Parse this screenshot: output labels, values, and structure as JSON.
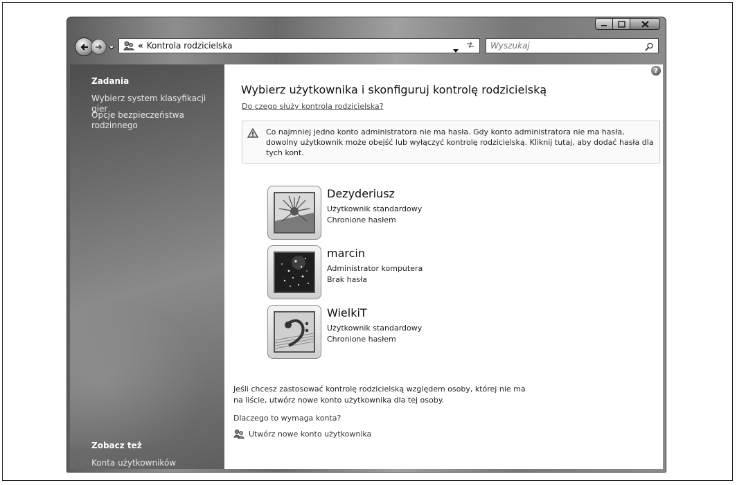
{
  "window": {
    "address": {
      "chevron": "«",
      "location": "Kontrola rodzicielska"
    },
    "search": {
      "placeholder": "Wyszukaj"
    }
  },
  "sidebar": {
    "tasks_title": "Zadania",
    "tasks": [
      "Wybierz system klasyfikacji gier",
      "Opcje bezpieczeństwa rodzinnego"
    ],
    "see_also_title": "Zobacz też",
    "see_also": [
      "Konta użytkowników"
    ]
  },
  "main": {
    "title": "Wybierz użytkownika i skonfiguruj kontrolę rodzicielską",
    "help_link": "Do czego służy kontrola rodzicielska?",
    "warning": "Co najmniej jedno konto administratora nie ma hasła. Gdy konto administratora nie ma hasła, dowolny użytkownik może obejść lub wyłączyć kontrolę rodzicielską. Kliknij tutaj, aby dodać hasła dla tych kont.",
    "users": [
      {
        "name": "Dezyderiusz",
        "type": "Użytkownik standardowy",
        "password": "Chronione hasłem"
      },
      {
        "name": "marcin",
        "type": "Administrator komputera",
        "password": "Brak hasła"
      },
      {
        "name": "WielkiT",
        "type": "Użytkownik standardowy",
        "password": "Chronione hasłem"
      }
    ],
    "info": "Jeśli chcesz zastosować kontrolę rodzicielską względem osoby, której nie ma na liście, utwórz nowe konto użytkownika dla tej osoby.",
    "why_link": "Dlaczego to wymaga konta?",
    "create_link": "Utwórz nowe konto użytkownika",
    "help_glyph": "?"
  }
}
